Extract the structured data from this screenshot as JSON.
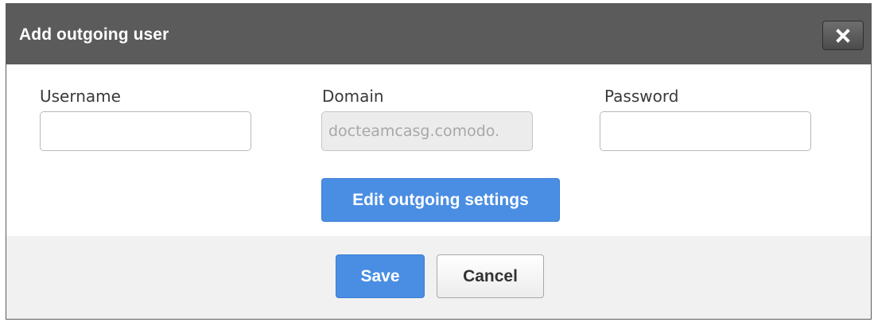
{
  "dialog": {
    "title": "Add outgoing user",
    "close_icon": "close-icon"
  },
  "fields": {
    "username": {
      "label": "Username",
      "value": ""
    },
    "domain": {
      "label": "Domain",
      "value": "docteamcasg.comodo.",
      "disabled": true
    },
    "password": {
      "label": "Password",
      "value": ""
    }
  },
  "actions": {
    "edit_outgoing_settings": "Edit outgoing settings",
    "save": "Save",
    "cancel": "Cancel"
  },
  "colors": {
    "titlebar": "#5b5b5b",
    "primary_button": "#4a8ee3",
    "footer": "#f1f1f1"
  }
}
